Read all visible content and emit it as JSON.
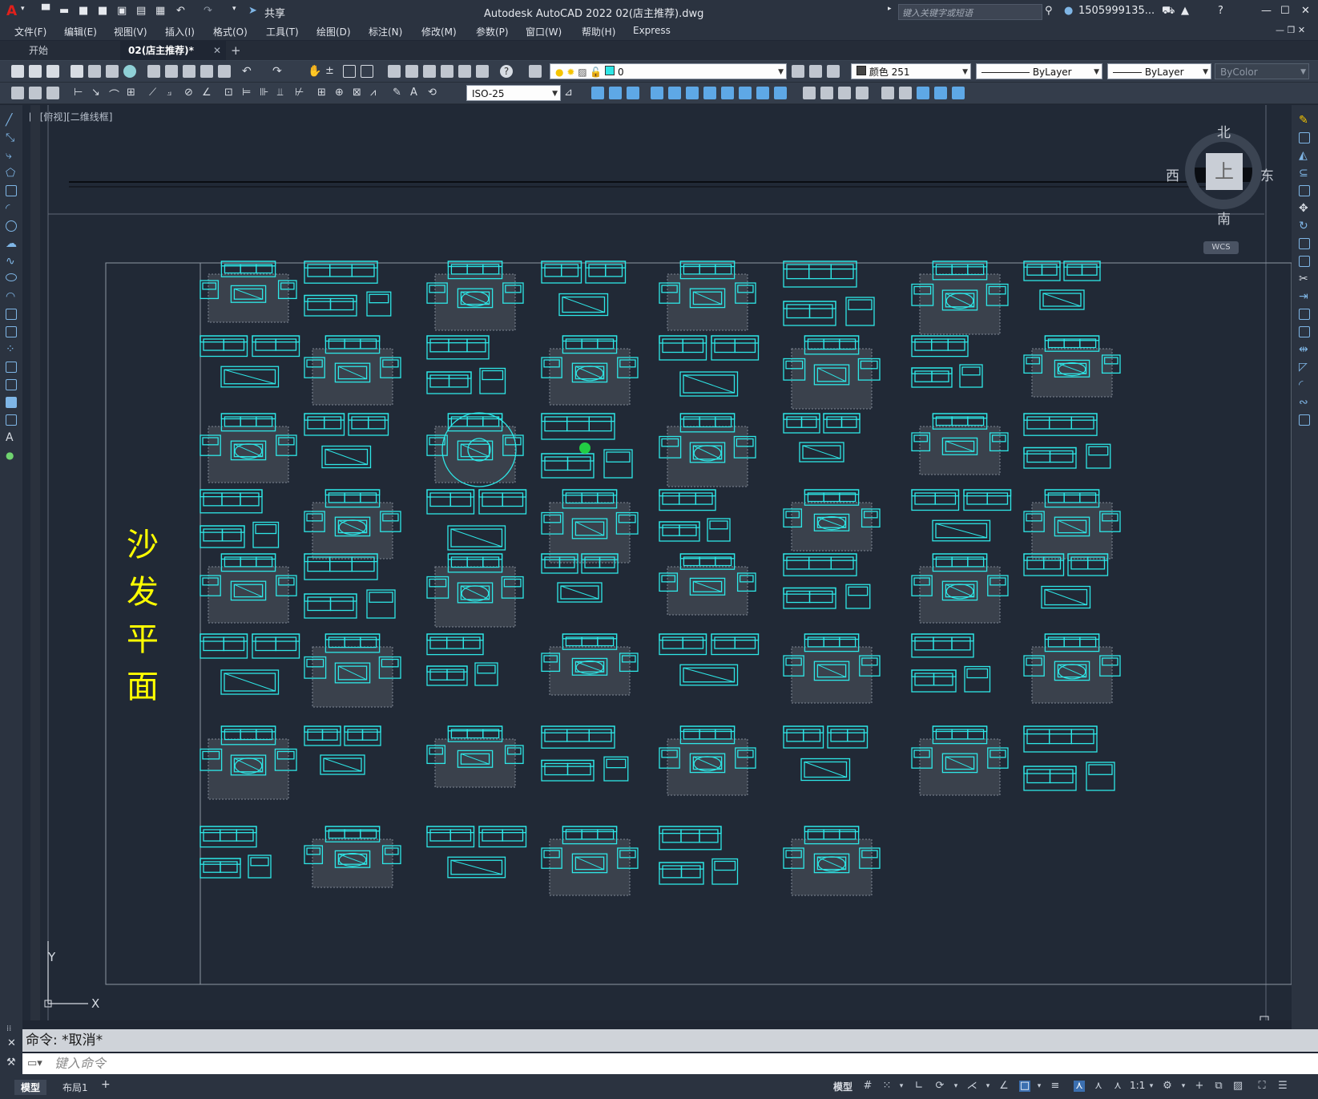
{
  "app": {
    "title": "Autodesk AutoCAD 2022    02(店主推荐).dwg",
    "logo": "A",
    "share_label": "共享",
    "search_placeholder": "键入关键字或短语",
    "user": "1505999135...",
    "window_controls": [
      "—",
      "☐",
      "✕"
    ]
  },
  "menu": [
    "文件(F)",
    "编辑(E)",
    "视图(V)",
    "插入(I)",
    "格式(O)",
    "工具(T)",
    "绘图(D)",
    "标注(N)",
    "修改(M)",
    "参数(P)",
    "窗口(W)",
    "帮助(H)",
    "Express"
  ],
  "tabs": [
    {
      "label": "开始",
      "active": false
    },
    {
      "label": "02(店主推荐)*",
      "active": true
    }
  ],
  "toolbar": {
    "layer_value": "0",
    "color_value": "颜色 251",
    "linetype_value": "ByLayer",
    "lineweight_value": "ByLayer",
    "plotstyle_value": "ByColor",
    "dimstyle_value": "ISO-25"
  },
  "viewport": {
    "label": "[-][俯视][二维线框]",
    "compass": {
      "north": "北",
      "south": "南",
      "east": "东",
      "west": "西",
      "top": "上"
    },
    "wcs": "WCS",
    "ucs_x": "X",
    "ucs_y": "Y"
  },
  "drawing": {
    "title_chars": [
      "沙",
      "发",
      "平",
      "面"
    ],
    "line_color": "#2ee6e6",
    "frame_color": "#8d96a3"
  },
  "command": {
    "history": "命令: *取消*",
    "input_placeholder": "键入命令"
  },
  "status": {
    "layout_tabs": [
      "模型",
      "布局1",
      "+"
    ],
    "model_label": "模型",
    "scale": "1:1"
  },
  "colors": {
    "accent_cyan": "#2ee6e6",
    "text_yellow": "#ffff00",
    "logo_red": "#e0201b"
  }
}
